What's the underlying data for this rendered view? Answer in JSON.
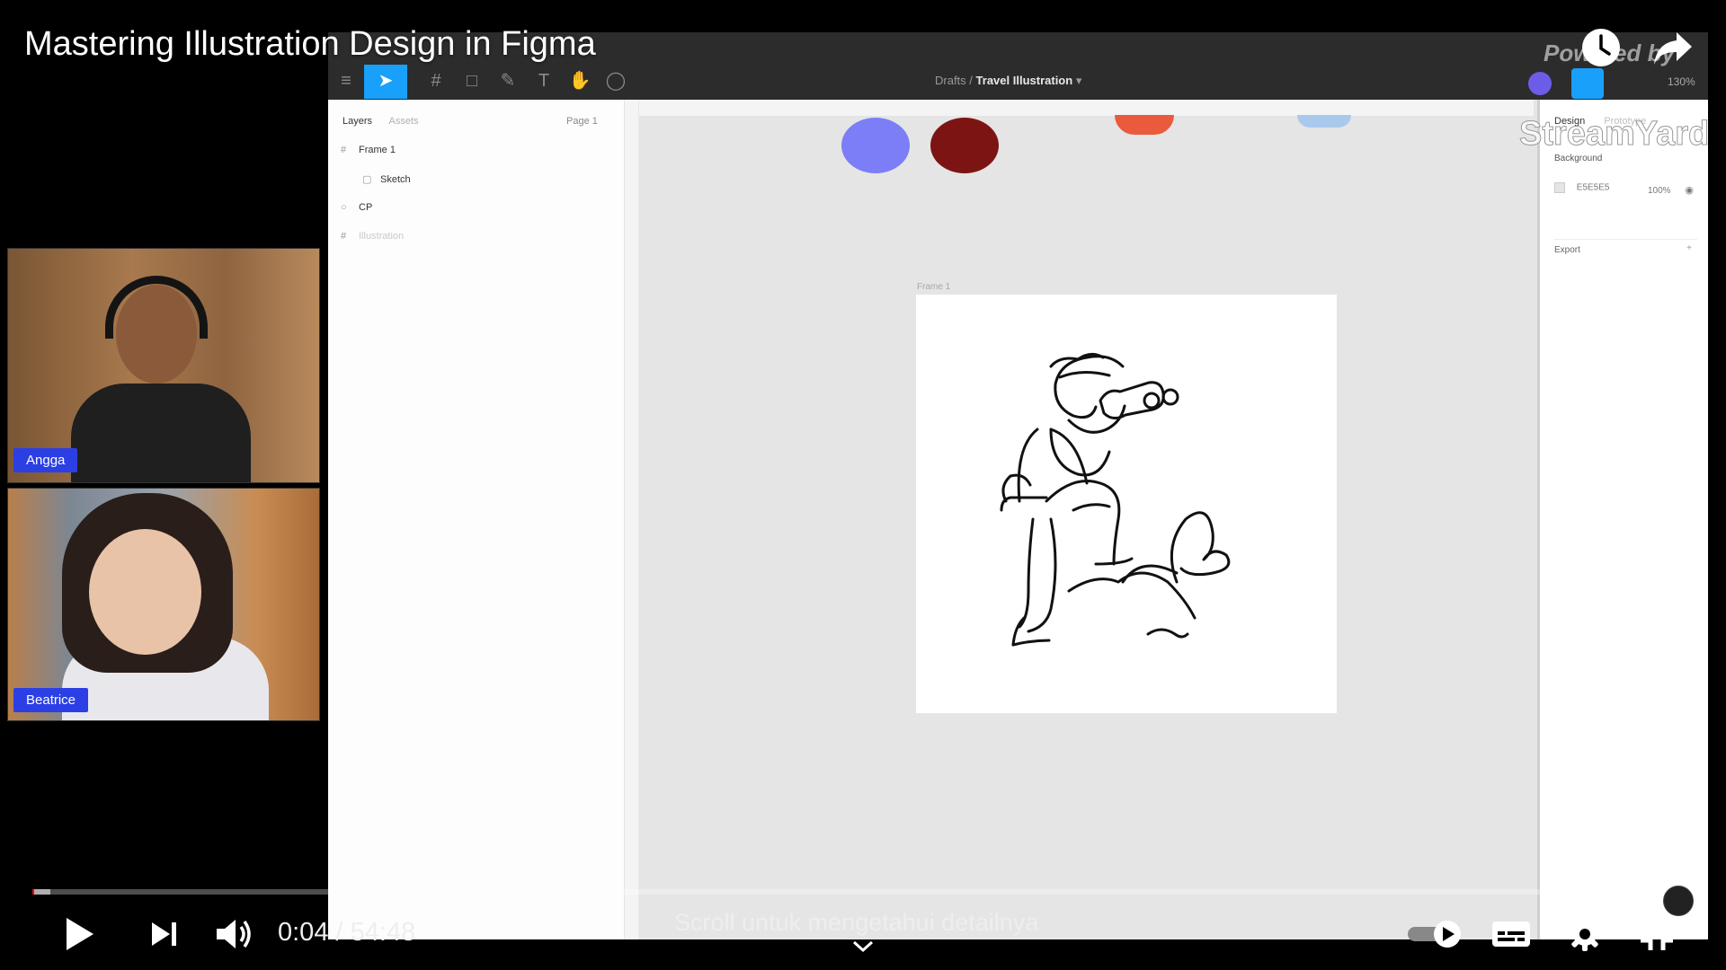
{
  "player": {
    "title": "Mastering Illustration Design in Figma",
    "time_current": "0:04",
    "time_separator": "/",
    "time_total": "54:48",
    "progress_fraction": 0.0012,
    "loaded_fraction": 0.011,
    "scroll_hint": "Scroll untuk mengetahui detailnya",
    "icons": [
      "clock-icon",
      "share-arrow-icon",
      "play-icon",
      "next-icon",
      "volume-icon",
      "autoplay-toggle",
      "subtitles-icon",
      "settings-gear-icon",
      "exit-fullscreen-icon",
      "chevron-down-icon"
    ]
  },
  "branding": {
    "powered_by": "Powered by",
    "streamyard": "StreamYard"
  },
  "figma": {
    "breadcrumb_parent": "Drafts",
    "breadcrumb_separator": "/",
    "file_name": "Travel Illustration",
    "zoom": "130%",
    "left_tabs": [
      "Layers",
      "Assets"
    ],
    "page_selector": "Page 1",
    "layers": [
      {
        "name": "Frame 1",
        "glyph": "#"
      },
      {
        "name": "Sketch",
        "glyph": "▢"
      },
      {
        "name": "CP",
        "glyph": "○"
      },
      {
        "name": "Illustration",
        "glyph": "#"
      }
    ],
    "frame_label": "Frame 1",
    "right_tabs": [
      "Design",
      "Prototype"
    ],
    "background_heading": "Background",
    "background_color": "E5E5E5",
    "background_opacity": "100%",
    "export_label": "Export",
    "swatch_colors": [
      "#7b7ef6",
      "#7d1414",
      "#ea5a3c",
      "#a9c9ec"
    ]
  },
  "participants": [
    {
      "name": "Angga"
    },
    {
      "name": "Beatrice"
    }
  ],
  "colors": {
    "accent_blue": "#18a0fb",
    "name_tag": "#2b3fe5",
    "progress_red": "#ff0000"
  }
}
